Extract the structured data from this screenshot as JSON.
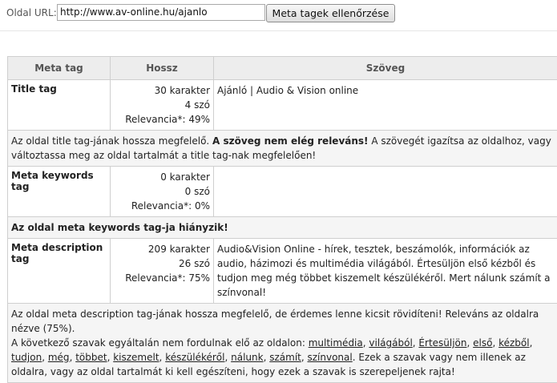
{
  "form": {
    "url_label": "Oldal URL:",
    "url_value": "http://www.av-online.hu/ajanlo",
    "submit_label": "Meta tagek ellenőrzése"
  },
  "table": {
    "headers": [
      "Meta tag",
      "Hossz",
      "Szöveg"
    ],
    "title": {
      "tag": "Title tag",
      "chars": "30 karakter",
      "words": "4 szó",
      "relevance": "Relevancia*: 49%",
      "text": "Ajánló | Audio & Vision online",
      "note_pre": "Az oldal title tag-jának hossza megfelelő. ",
      "note_bold": "A szöveg nem elég releváns!",
      "note_post": " A szövegét igazítsa az oldalhoz, vagy változtassa meg az oldal tartalmát a title tag-nak megfelelően!"
    },
    "keywords": {
      "tag": "Meta keywords tag",
      "chars": "0 karakter",
      "words": "0 szó",
      "relevance": "Relevancia*: 0%",
      "text": "",
      "note": "Az oldal meta keywords tag-ja hiányzik!"
    },
    "description": {
      "tag": "Meta description tag",
      "chars": "209 karakter",
      "words": "26 szó",
      "relevance": "Relevancia*: 75%",
      "text": "Audio&Vision Online - hírek, tesztek, beszámolók, információk az audio, házimozi és multimédia világából. Értesüljön első kézből és tudjon meg még többet kiszemelt készülékéről. Mert nálunk számít a színvonal!",
      "note_line1": "Az oldal meta description tag-jának hossza megfelelő, de érdemes lenne kicsit rövidíteni! Releváns az oldalra nézve (75%).",
      "note_line2_pre": "A következő szavak egyáltalán nem fordulnak elő az oldalon: ",
      "missing_words": [
        "multimédia",
        "világából",
        "Értesüljön",
        "első",
        "kézből",
        "tudjon",
        "még",
        "többet",
        "kiszemelt",
        "készülékéről",
        "nálunk",
        "számít",
        "színvonal"
      ],
      "note_post": ". Ezek a szavak vagy nem illenek az oldalra, vagy az oldal tartalmát ki kell egészíteni, hogy ezek a szavak is szerepeljenek rajta!"
    }
  }
}
